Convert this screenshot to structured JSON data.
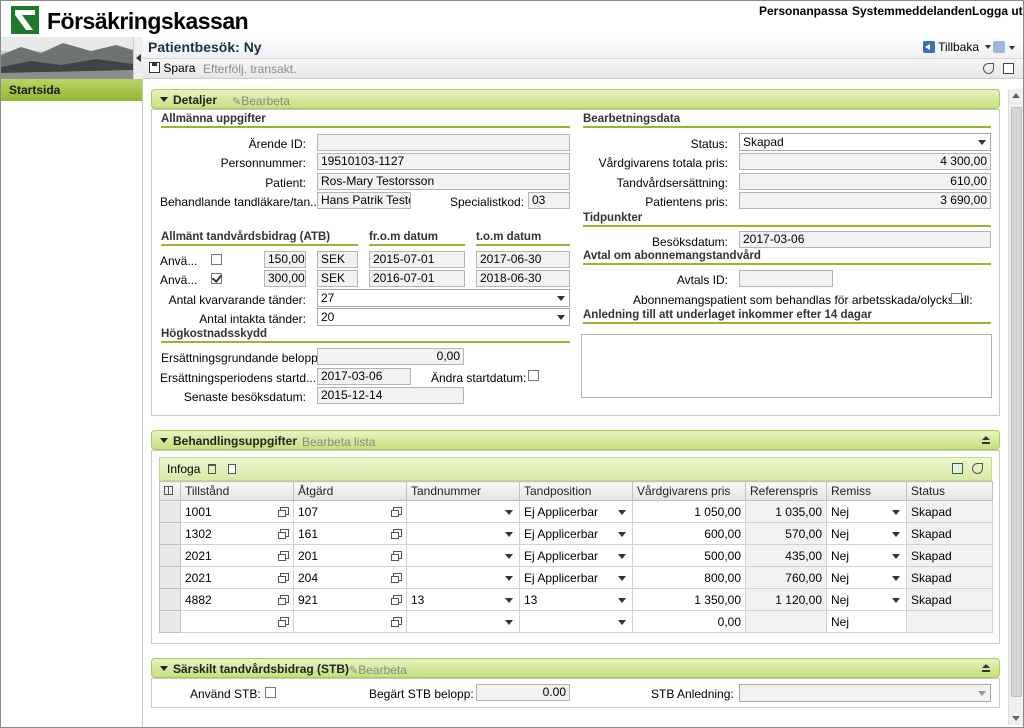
{
  "header": {
    "logo_text": "Försäkringskassan",
    "nav": [
      "Personanpassa",
      "Systemmeddelanden",
      "Logga ut"
    ]
  },
  "page": {
    "title": "Patientbesök: Ny",
    "back_label": "Tillbaka",
    "save_label": "Spara",
    "followup_label": "Efterfölj. transakt."
  },
  "sidebar": {
    "items": [
      {
        "label": "Startsida"
      }
    ]
  },
  "details": {
    "title": "Detaljer",
    "edit_label": "Bearbeta",
    "general": {
      "heading": "Allmänna uppgifter",
      "arende_label": "Ärende ID:",
      "arende_value": "",
      "personnr_label": "Personnummer:",
      "personnr_value": "19510103-1127",
      "patient_label": "Patient:",
      "patient_value": "Ros-Mary Testorsson",
      "dentist_label": "Behandlande tandläkare/tan...",
      "dentist_value": "Hans Patrik Testor",
      "special_label": "Specialistkod:",
      "special_value": "03"
    },
    "atb": {
      "heading": "Allmänt tandvårdsbidrag (ATB)",
      "from_heading": "fr.o.m datum",
      "to_heading": "t.o.m datum",
      "rows": [
        {
          "label": "Anvä...",
          "checked": false,
          "amount": "150,00",
          "currency": "SEK",
          "from": "2015-07-01",
          "to": "2017-06-30"
        },
        {
          "label": "Anvä...",
          "checked": true,
          "amount": "300,00",
          "currency": "SEK",
          "from": "2016-07-01",
          "to": "2018-06-30"
        }
      ],
      "remaining_label": "Antal kvarvarande tänder:",
      "remaining_value": "27",
      "intact_label": "Antal intakta tänder:",
      "intact_value": "20"
    },
    "hkk": {
      "heading": "Högkostnadsskydd",
      "basis_label": "Ersättningsgrundande belopp:",
      "basis_value": "0,00",
      "period_label": "Ersättningsperiodens startd...",
      "period_value": "2017-03-06",
      "change_label": "Ändra startdatum:",
      "last_label": "Senaste besöksdatum:",
      "last_value": "2015-12-14"
    },
    "processing": {
      "heading": "Bearbetningsdata",
      "status_label": "Status:",
      "status_value": "Skapad",
      "total_label": "Vårdgivarens totala pris:",
      "total_value": "4 300,00",
      "comp_label": "Tandvårdsersättning:",
      "comp_value": "610,00",
      "patient_price_label": "Patientens pris:",
      "patient_price_value": "3 690,00"
    },
    "times": {
      "heading": "Tidpunkter",
      "visit_label": "Besöksdatum:",
      "visit_value": "2017-03-06"
    },
    "subscription": {
      "heading": "Avtal om abonnemangstandvård",
      "id_label": "Avtals ID:",
      "id_value": "",
      "injury_label": "Abonnemangspatient som behandlas för arbetsskada/olycksfall:"
    },
    "reason": {
      "heading": "Anledning till att underlaget inkommer efter 14 dagar",
      "value": ""
    }
  },
  "treatment": {
    "title": "Behandlingsuppgifter",
    "edit_label": "Bearbeta lista",
    "insert_label": "Infoga",
    "columns": [
      "Tillstånd",
      "Åtgärd",
      "Tandnummer",
      "Tandposition",
      "Vårdgivarens pris",
      "Referenspris",
      "Remiss",
      "Status"
    ],
    "rows": [
      {
        "tillstand": "1001",
        "atgard": "107",
        "tandnr": "",
        "tandpos": "Ej Applicerbar",
        "pris": "1 050,00",
        "ref": "1 035,00",
        "remiss": "Nej",
        "status": "Skapad"
      },
      {
        "tillstand": "1302",
        "atgard": "161",
        "tandnr": "",
        "tandpos": "Ej Applicerbar",
        "pris": "600,00",
        "ref": "570,00",
        "remiss": "Nej",
        "status": "Skapad"
      },
      {
        "tillstand": "2021",
        "atgard": "201",
        "tandnr": "",
        "tandpos": "Ej Applicerbar",
        "pris": "500,00",
        "ref": "435,00",
        "remiss": "Nej",
        "status": "Skapad"
      },
      {
        "tillstand": "2021",
        "atgard": "204",
        "tandnr": "",
        "tandpos": "Ej Applicerbar",
        "pris": "800,00",
        "ref": "760,00",
        "remiss": "Nej",
        "status": "Skapad"
      },
      {
        "tillstand": "4882",
        "atgard": "921",
        "tandnr": "13",
        "tandpos": "13",
        "pris": "1 350,00",
        "ref": "1 120,00",
        "remiss": "Nej",
        "status": "Skapad"
      },
      {
        "tillstand": "",
        "atgard": "",
        "tandnr": "",
        "tandpos": "",
        "pris": "0,00",
        "ref": "",
        "remiss": "Nej",
        "status": ""
      }
    ]
  },
  "stb": {
    "title": "Särskilt tandvårdsbidrag (STB)",
    "edit_label": "Bearbeta",
    "use_label": "Använd STB:",
    "amount_label": "Begärt STB belopp:",
    "amount_value": "0.00",
    "reason_label": "STB Anledning:",
    "reason_value": ""
  }
}
